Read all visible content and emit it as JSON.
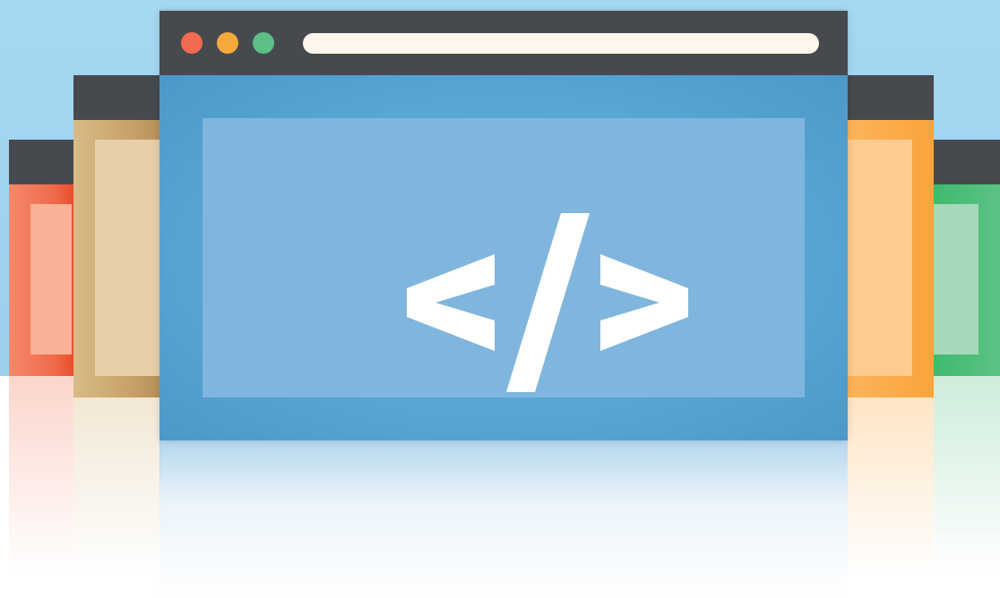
{
  "scene": {
    "sky_color": "#a6d8f2",
    "ground_color": "#ffffff"
  },
  "main_window": {
    "frame_color": "#464a4f",
    "dots": [
      {
        "name": "close",
        "color": "#f26a50"
      },
      {
        "name": "minimize",
        "color": "#f6a93b"
      },
      {
        "name": "maximize",
        "color": "#5cbf87"
      }
    ],
    "address_bar": {
      "color": "#fcf6ec",
      "value": ""
    },
    "content_color": "#58a6d5",
    "icon": "code-brackets-icon",
    "icon_color": "#ffffff"
  },
  "background_windows": [
    {
      "name": "far-left",
      "color": "#ef6a4a"
    },
    {
      "name": "left",
      "color": "#c9a46a"
    },
    {
      "name": "right",
      "color": "#faa43c"
    },
    {
      "name": "far-right",
      "color": "#5cc286"
    }
  ]
}
